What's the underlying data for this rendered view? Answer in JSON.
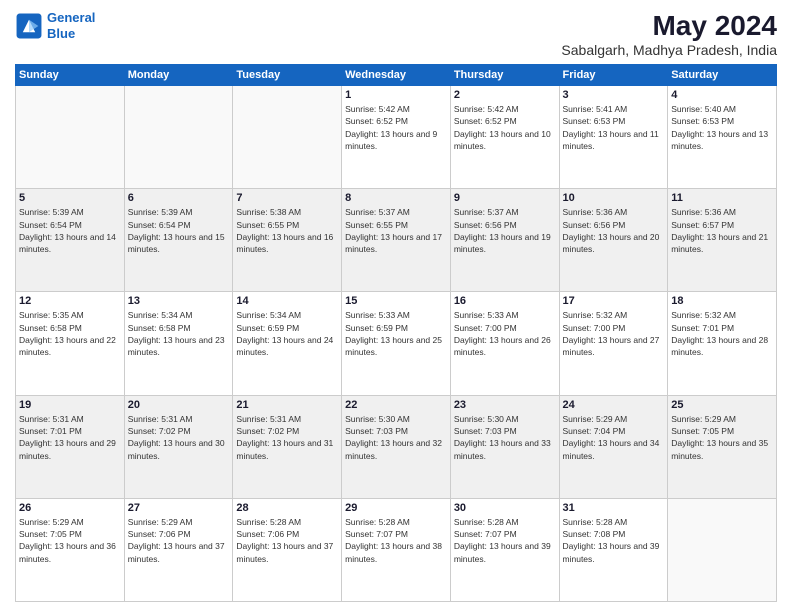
{
  "logo": {
    "line1": "General",
    "line2": "Blue"
  },
  "title": "May 2024",
  "subtitle": "Sabalgarh, Madhya Pradesh, India",
  "days_of_week": [
    "Sunday",
    "Monday",
    "Tuesday",
    "Wednesday",
    "Thursday",
    "Friday",
    "Saturday"
  ],
  "weeks": [
    [
      {
        "day": "",
        "empty": true
      },
      {
        "day": "",
        "empty": true
      },
      {
        "day": "",
        "empty": true
      },
      {
        "day": "1",
        "sunrise": "5:42 AM",
        "sunset": "6:52 PM",
        "daylight": "13 hours and 9 minutes."
      },
      {
        "day": "2",
        "sunrise": "5:42 AM",
        "sunset": "6:52 PM",
        "daylight": "13 hours and 10 minutes."
      },
      {
        "day": "3",
        "sunrise": "5:41 AM",
        "sunset": "6:53 PM",
        "daylight": "13 hours and 11 minutes."
      },
      {
        "day": "4",
        "sunrise": "5:40 AM",
        "sunset": "6:53 PM",
        "daylight": "13 hours and 13 minutes."
      }
    ],
    [
      {
        "day": "5",
        "sunrise": "5:39 AM",
        "sunset": "6:54 PM",
        "daylight": "13 hours and 14 minutes."
      },
      {
        "day": "6",
        "sunrise": "5:39 AM",
        "sunset": "6:54 PM",
        "daylight": "13 hours and 15 minutes."
      },
      {
        "day": "7",
        "sunrise": "5:38 AM",
        "sunset": "6:55 PM",
        "daylight": "13 hours and 16 minutes."
      },
      {
        "day": "8",
        "sunrise": "5:37 AM",
        "sunset": "6:55 PM",
        "daylight": "13 hours and 17 minutes."
      },
      {
        "day": "9",
        "sunrise": "5:37 AM",
        "sunset": "6:56 PM",
        "daylight": "13 hours and 19 minutes."
      },
      {
        "day": "10",
        "sunrise": "5:36 AM",
        "sunset": "6:56 PM",
        "daylight": "13 hours and 20 minutes."
      },
      {
        "day": "11",
        "sunrise": "5:36 AM",
        "sunset": "6:57 PM",
        "daylight": "13 hours and 21 minutes."
      }
    ],
    [
      {
        "day": "12",
        "sunrise": "5:35 AM",
        "sunset": "6:58 PM",
        "daylight": "13 hours and 22 minutes."
      },
      {
        "day": "13",
        "sunrise": "5:34 AM",
        "sunset": "6:58 PM",
        "daylight": "13 hours and 23 minutes."
      },
      {
        "day": "14",
        "sunrise": "5:34 AM",
        "sunset": "6:59 PM",
        "daylight": "13 hours and 24 minutes."
      },
      {
        "day": "15",
        "sunrise": "5:33 AM",
        "sunset": "6:59 PM",
        "daylight": "13 hours and 25 minutes."
      },
      {
        "day": "16",
        "sunrise": "5:33 AM",
        "sunset": "7:00 PM",
        "daylight": "13 hours and 26 minutes."
      },
      {
        "day": "17",
        "sunrise": "5:32 AM",
        "sunset": "7:00 PM",
        "daylight": "13 hours and 27 minutes."
      },
      {
        "day": "18",
        "sunrise": "5:32 AM",
        "sunset": "7:01 PM",
        "daylight": "13 hours and 28 minutes."
      }
    ],
    [
      {
        "day": "19",
        "sunrise": "5:31 AM",
        "sunset": "7:01 PM",
        "daylight": "13 hours and 29 minutes."
      },
      {
        "day": "20",
        "sunrise": "5:31 AM",
        "sunset": "7:02 PM",
        "daylight": "13 hours and 30 minutes."
      },
      {
        "day": "21",
        "sunrise": "5:31 AM",
        "sunset": "7:02 PM",
        "daylight": "13 hours and 31 minutes."
      },
      {
        "day": "22",
        "sunrise": "5:30 AM",
        "sunset": "7:03 PM",
        "daylight": "13 hours and 32 minutes."
      },
      {
        "day": "23",
        "sunrise": "5:30 AM",
        "sunset": "7:03 PM",
        "daylight": "13 hours and 33 minutes."
      },
      {
        "day": "24",
        "sunrise": "5:29 AM",
        "sunset": "7:04 PM",
        "daylight": "13 hours and 34 minutes."
      },
      {
        "day": "25",
        "sunrise": "5:29 AM",
        "sunset": "7:05 PM",
        "daylight": "13 hours and 35 minutes."
      }
    ],
    [
      {
        "day": "26",
        "sunrise": "5:29 AM",
        "sunset": "7:05 PM",
        "daylight": "13 hours and 36 minutes."
      },
      {
        "day": "27",
        "sunrise": "5:29 AM",
        "sunset": "7:06 PM",
        "daylight": "13 hours and 37 minutes."
      },
      {
        "day": "28",
        "sunrise": "5:28 AM",
        "sunset": "7:06 PM",
        "daylight": "13 hours and 37 minutes."
      },
      {
        "day": "29",
        "sunrise": "5:28 AM",
        "sunset": "7:07 PM",
        "daylight": "13 hours and 38 minutes."
      },
      {
        "day": "30",
        "sunrise": "5:28 AM",
        "sunset": "7:07 PM",
        "daylight": "13 hours and 39 minutes."
      },
      {
        "day": "31",
        "sunrise": "5:28 AM",
        "sunset": "7:08 PM",
        "daylight": "13 hours and 39 minutes."
      },
      {
        "day": "",
        "empty": true
      }
    ]
  ]
}
